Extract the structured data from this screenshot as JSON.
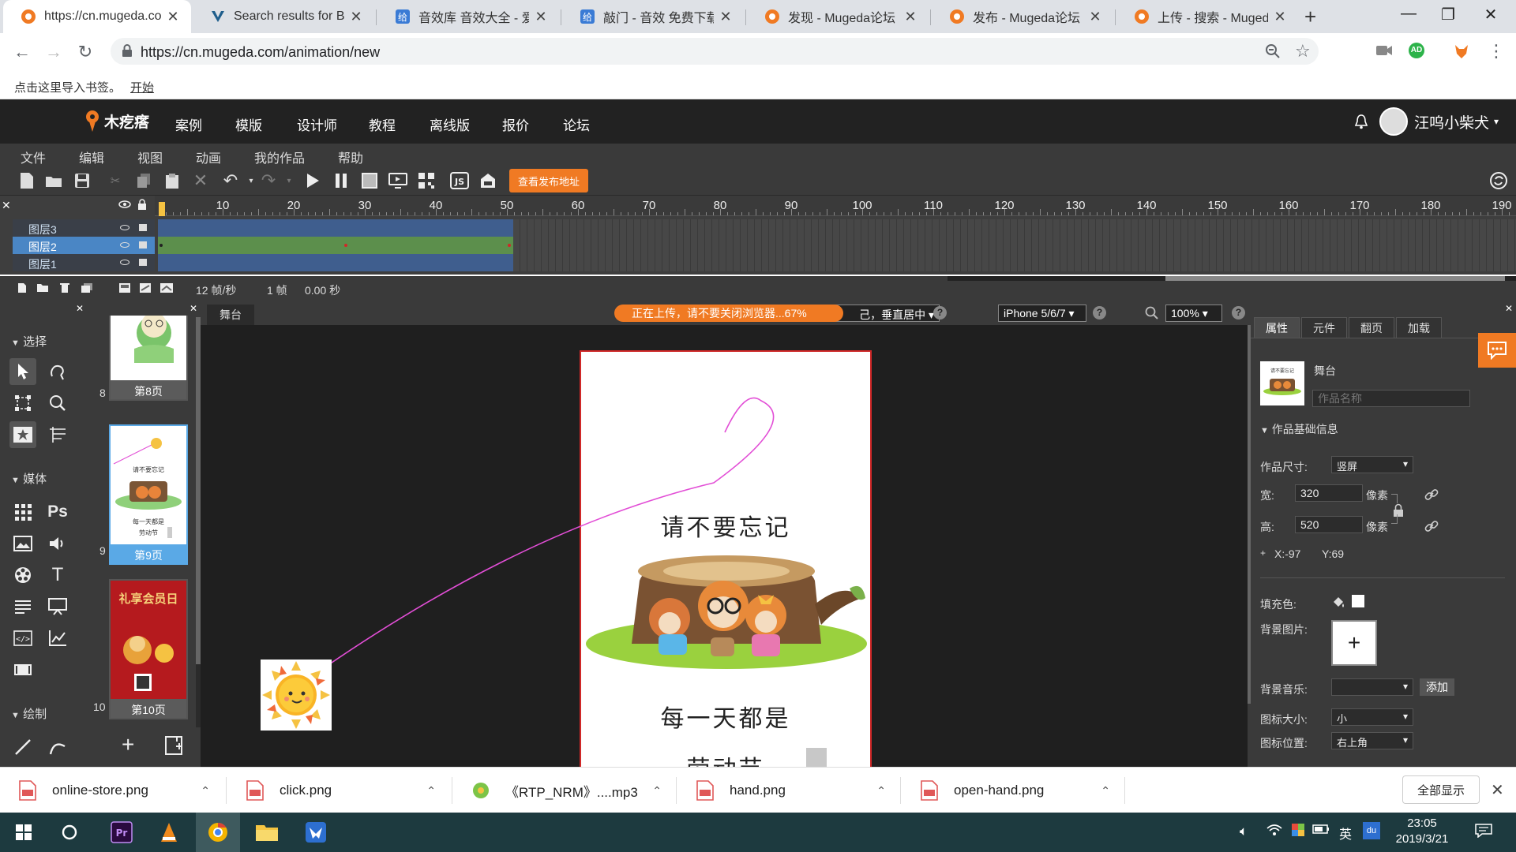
{
  "browser": {
    "tabs": [
      {
        "label": "https://cn.mugeda.co",
        "favicon": "mugeda-logo"
      },
      {
        "label": "Search results for Blu",
        "favicon": "v-logo"
      },
      {
        "label": "音效库 音效大全 - 爱给",
        "favicon": "site-logo"
      },
      {
        "label": "敲门 - 音效 免费下载",
        "favicon": "site-logo"
      },
      {
        "label": "发现 - Mugeda论坛",
        "favicon": "mugeda-logo"
      },
      {
        "label": "发布 - Mugeda论坛",
        "favicon": "mugeda-logo"
      },
      {
        "label": "上传 - 搜索 - Mugeda",
        "favicon": "mugeda-logo"
      }
    ],
    "url": "https://cn.mugeda.com/animation/new",
    "bookmark_prompt": "点击这里导入书签。",
    "bookmark_link": "开始",
    "profile_badge": "AD"
  },
  "site": {
    "logo_text": "木疙瘩",
    "nav": [
      "案例",
      "模版",
      "设计师",
      "教程",
      "离线版",
      "报价",
      "论坛"
    ],
    "username": "汪呜小柴犬"
  },
  "editor": {
    "menu": [
      "文件",
      "编辑",
      "视图",
      "动画",
      "我的作品",
      "帮助"
    ],
    "publish_button": "查看发布地址",
    "timeline": {
      "ruler_labels": [
        "10",
        "20",
        "30",
        "40",
        "50",
        "60",
        "70",
        "80",
        "90",
        "100",
        "110",
        "120",
        "130",
        "140",
        "150",
        "160",
        "170",
        "180",
        "190"
      ],
      "layers": [
        {
          "name": "图层3",
          "selected": false
        },
        {
          "name": "图层2",
          "selected": true
        },
        {
          "name": "图层1",
          "selected": false
        }
      ],
      "fps": "12 帧/秒",
      "frame": "1 帧",
      "time": "0.00 秒"
    },
    "tools": {
      "sections": [
        "选择",
        "媒体",
        "绘制"
      ]
    },
    "pages": [
      {
        "num": "8",
        "label": "第8页"
      },
      {
        "num": "9",
        "label": "第9页"
      },
      {
        "num": "10",
        "label": "第10页"
      }
    ],
    "stage": {
      "tab": "舞台",
      "upload_status": "正在上传，请不要关闭浏览器...67%",
      "upload_progress": 0.67,
      "align_select": "己，垂直居中",
      "device_select": "iPhone 5/6/7",
      "zoom_select": "100%",
      "canvas_text_1": "请不要忘记",
      "canvas_text_2": "每一天都是",
      "canvas_text_3": "劳动节"
    },
    "props": {
      "tabs": [
        "属性",
        "元件",
        "翻页",
        "加载"
      ],
      "stage_label": "舞台",
      "name_placeholder": "作品名称",
      "section_title": "作品基础信息",
      "size_label": "作品尺寸:",
      "size_value": "竖屏",
      "width_label": "宽:",
      "width_value": "320",
      "height_label": "高:",
      "height_value": "520",
      "unit": "像素",
      "x_coord": "X:-97",
      "y_coord": "Y:69",
      "fill_label": "填充色:",
      "bg_image_label": "背景图片:",
      "bg_music_label": "背景音乐:",
      "add_button": "添加",
      "icon_size_label": "图标大小:",
      "icon_size_value": "小",
      "icon_pos_label": "图标位置:",
      "icon_pos_value": "右上角"
    }
  },
  "downloads": {
    "items": [
      "online-store.png",
      "click.png",
      "《RTP_NRM》....mp3",
      "hand.png",
      "open-hand.png"
    ],
    "show_all": "全部显示"
  },
  "taskbar": {
    "time": "23:05",
    "date": "2019/3/21",
    "ime": "英"
  },
  "colors": {
    "accent": "#f07a23",
    "selection_blue": "#4a86c5",
    "canvas_border": "#d02828"
  }
}
